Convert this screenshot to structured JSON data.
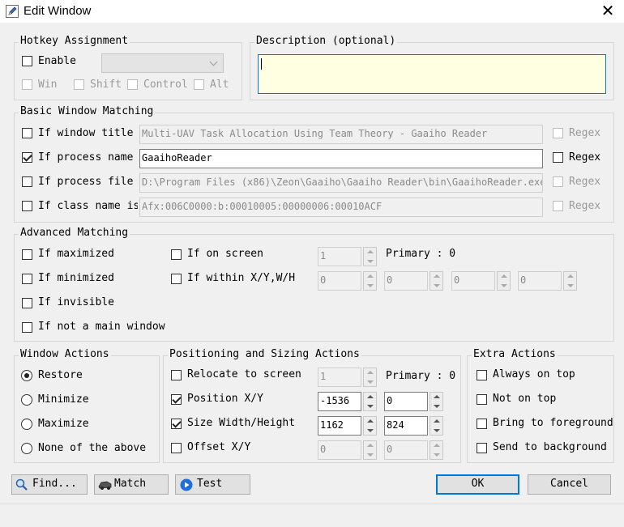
{
  "window": {
    "title": "Edit Window",
    "close_glyph": "✕"
  },
  "hotkey": {
    "title": "Hotkey Assignment",
    "enable": "Enable",
    "win": "Win",
    "shift": "Shift",
    "control": "Control",
    "alt": "Alt",
    "combo_value": ""
  },
  "description": {
    "title": "Description (optional)",
    "value": ""
  },
  "basic": {
    "title": "Basic Window Matching",
    "rows": [
      {
        "label": "If window title is",
        "value": "Multi-UAV Task Allocation Using Team Theory - Gaaiho Reader",
        "checked": false,
        "regex": "Regex"
      },
      {
        "label": "If process name is",
        "value": "GaaihoReader",
        "checked": true,
        "regex": "Regex"
      },
      {
        "label": "If process file is",
        "value": "D:\\Program Files (x86)\\Zeon\\Gaaiho\\Gaaiho Reader\\bin\\GaaihoReader.exe",
        "checked": false,
        "regex": "Regex"
      },
      {
        "label": "If class name is",
        "value": "Afx:006C0000:b:00010005:00000006:00010ACF",
        "checked": false,
        "regex": "Regex"
      }
    ]
  },
  "advanced": {
    "title": "Advanced Matching",
    "if_maximized": "If maximized",
    "if_minimized": "If minimized",
    "if_invisible": "If invisible",
    "if_not_main": "If not a main window",
    "if_on_screen": "If on screen",
    "if_within": "If within X/Y,W/H",
    "screen_value": "1",
    "primary": "Primary : 0",
    "within_values": [
      "0",
      "0",
      "0",
      "0"
    ]
  },
  "window_actions": {
    "title": "Window Actions",
    "restore": "Restore",
    "minimize": "Minimize",
    "maximize": "Maximize",
    "none": "None of the above",
    "selected": "Restore"
  },
  "positioning": {
    "title": "Positioning and Sizing Actions",
    "relocate": "Relocate to screen",
    "relocate_value": "1",
    "primary": "Primary : 0",
    "position": "Position X/Y",
    "pos_x": "-1536",
    "pos_y": "0",
    "size": "Size Width/Height",
    "width": "1162",
    "height": "824",
    "offset": "Offset X/Y",
    "off_x": "0",
    "off_y": "0"
  },
  "extra": {
    "title": "Extra Actions",
    "always_on_top": "Always on top",
    "not_on_top": "Not on top",
    "bring_fg": "Bring to foreground",
    "send_bg": "Send to background"
  },
  "buttons": {
    "find": "Find...",
    "match": "Match",
    "test": "Test",
    "ok": "OK",
    "cancel": "Cancel"
  },
  "icons": {
    "title_icon": "edit-window-icon",
    "find_icon": "magnifier-icon",
    "match_icon": "truck-icon",
    "test_icon": "play-icon"
  },
  "colors": {
    "description_bg": "#ffffe1",
    "focus_border": "#0078d7"
  }
}
